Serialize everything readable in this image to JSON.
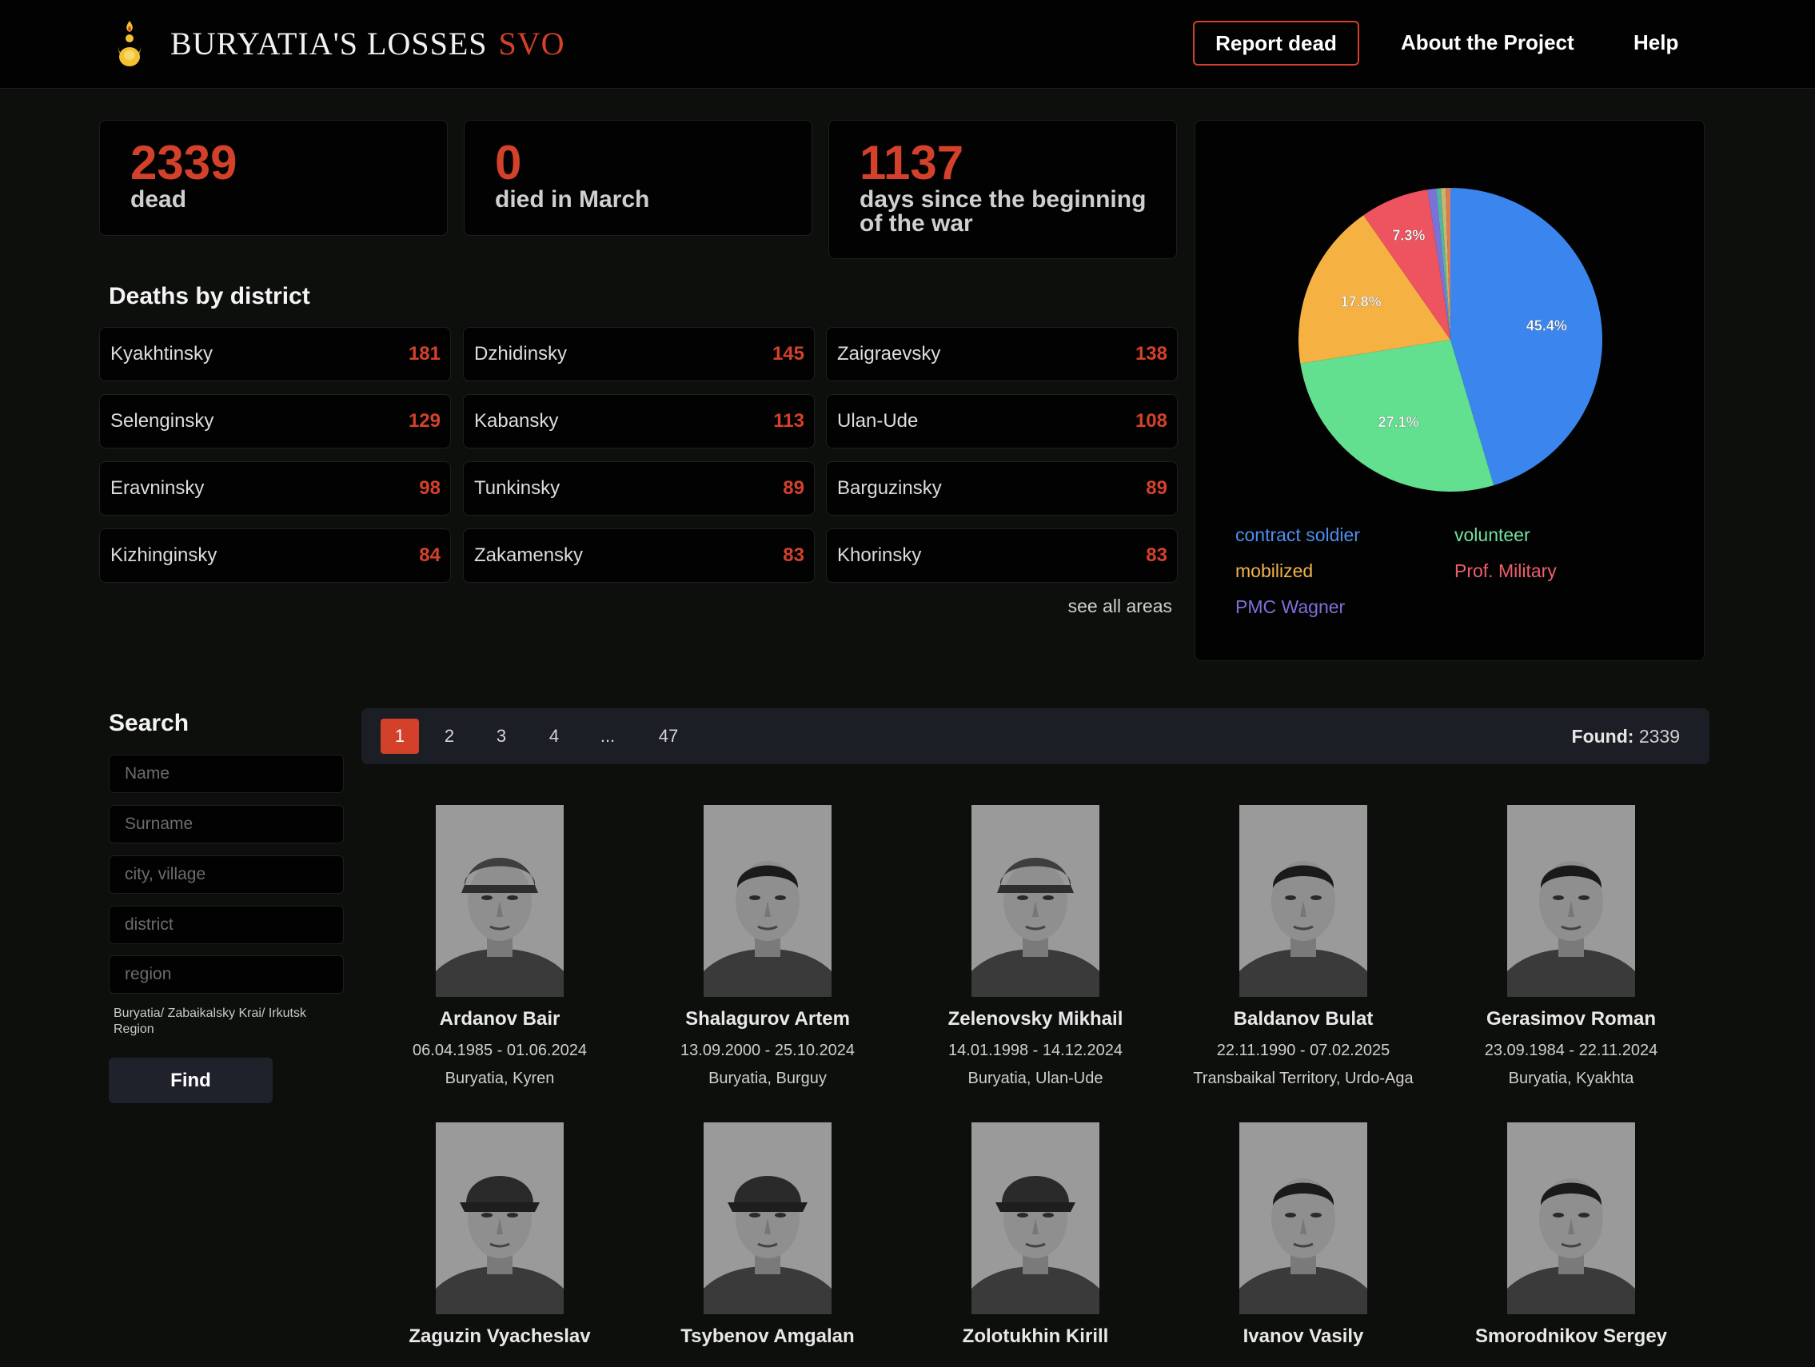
{
  "header": {
    "logo_icon": "soyombo-flame-icon",
    "title": "BURYATIA'S LOSSES",
    "title_accent": "SVO",
    "report_button": "Report dead",
    "nav": [
      "About the Project",
      "Help"
    ]
  },
  "stats": [
    {
      "value": "2339",
      "label": "dead"
    },
    {
      "value": "0",
      "label": "died in March"
    },
    {
      "value": "1137",
      "label": "days since the beginning of the war"
    }
  ],
  "districts": {
    "title": "Deaths by district",
    "items": [
      {
        "name": "Kyakhtinsky",
        "count": "181"
      },
      {
        "name": "Dzhidinsky",
        "count": "145"
      },
      {
        "name": "Zaigraevsky",
        "count": "138"
      },
      {
        "name": "Selenginsky",
        "count": "129"
      },
      {
        "name": "Kabansky",
        "count": "113"
      },
      {
        "name": "Ulan-Ude",
        "count": "108"
      },
      {
        "name": "Eravninsky",
        "count": "98"
      },
      {
        "name": "Tunkinsky",
        "count": "89"
      },
      {
        "name": "Barguzinsky",
        "count": "89"
      },
      {
        "name": "Kizhinginsky",
        "count": "84"
      },
      {
        "name": "Zakamensky",
        "count": "83"
      },
      {
        "name": "Khorinsky",
        "count": "83"
      }
    ],
    "see_all": "see all areas"
  },
  "chart_data": {
    "type": "pie",
    "slices": [
      {
        "label": "contract soldier",
        "value": 45.4,
        "display": "45.4%",
        "color": "#3b86ee"
      },
      {
        "label": "volunteer",
        "value": 27.1,
        "display": "27.1%",
        "color": "#62df8f"
      },
      {
        "label": "mobilized",
        "value": 17.8,
        "display": "17.8%",
        "color": "#f6b143"
      },
      {
        "label": "Prof. Military",
        "value": 7.3,
        "display": "7.3%",
        "color": "#ee5360"
      },
      {
        "label": "PMC Wagner",
        "value": 0.9,
        "display": "",
        "color": "#7b72d9"
      },
      {
        "label": "",
        "value": 0.5,
        "display": "",
        "color": "#4fb7a0"
      },
      {
        "label": "",
        "value": 0.5,
        "display": "",
        "color": "#c7b86e"
      },
      {
        "label": "",
        "value": 0.5,
        "display": "",
        "color": "#e07a55"
      }
    ],
    "legend": [
      {
        "label": "contract soldier",
        "color": "#4e8ef0"
      },
      {
        "label": "volunteer",
        "color": "#6fe3a0"
      },
      {
        "label": "mobilized",
        "color": "#f4b24a"
      },
      {
        "label": "Prof. Military",
        "color": "#ef5f6a"
      },
      {
        "label": "PMC Wagner",
        "color": "#7b72d9"
      }
    ]
  },
  "search": {
    "title": "Search",
    "fields": [
      {
        "placeholder": "Name"
      },
      {
        "placeholder": "Surname"
      },
      {
        "placeholder": "city, village"
      },
      {
        "placeholder": "district"
      },
      {
        "placeholder": "region"
      }
    ],
    "region_hint": "Buryatia/ Zabaikalsky Krai/ Irkutsk Region",
    "find_button": "Find"
  },
  "pagination": {
    "pages": [
      "1",
      "2",
      "3",
      "4",
      "...",
      "47"
    ],
    "active": "1",
    "found_label": "Found:",
    "found_count": "2339"
  },
  "people": [
    {
      "name": "Ardanov Bair",
      "dates": "06.04.1985 - 01.06.2024",
      "place": "Buryatia, Kyren",
      "headwear": "helmet"
    },
    {
      "name": "Shalagurov Artem",
      "dates": "13.09.2000 - 25.10.2024",
      "place": "Buryatia, Burguy",
      "headwear": "none"
    },
    {
      "name": "Zelenovsky Mikhail",
      "dates": "14.01.1998 - 14.12.2024",
      "place": "Buryatia, Ulan-Ude",
      "headwear": "helmet"
    },
    {
      "name": "Baldanov Bulat",
      "dates": "22.11.1990 - 07.02.2025",
      "place": "Transbaikal Territory, Urdo-Aga",
      "headwear": "none"
    },
    {
      "name": "Gerasimov Roman",
      "dates": "23.09.1984 - 22.11.2024",
      "place": "Buryatia, Kyakhta",
      "headwear": "none"
    },
    {
      "name": "Zaguzin Vyacheslav",
      "dates": "",
      "place": "",
      "headwear": "cap"
    },
    {
      "name": "Tsybenov Amgalan",
      "dates": "",
      "place": "",
      "headwear": "cap"
    },
    {
      "name": "Zolotukhin Kirill",
      "dates": "",
      "place": "",
      "headwear": "cap"
    },
    {
      "name": "Ivanov Vasily",
      "dates": "",
      "place": "",
      "headwear": "none"
    },
    {
      "name": "Smorodnikov Sergey",
      "dates": "",
      "place": "",
      "headwear": "none"
    }
  ]
}
